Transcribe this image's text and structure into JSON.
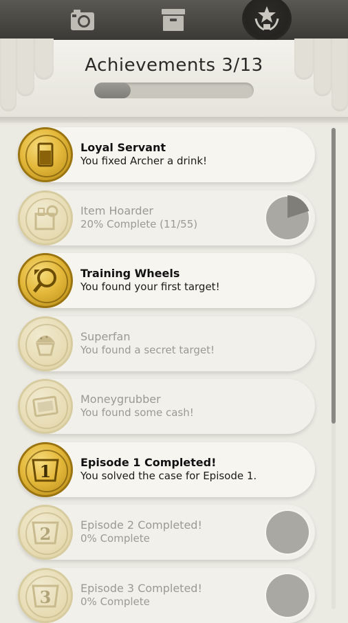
{
  "tabs": [
    {
      "icon": "camera-icon"
    },
    {
      "icon": "box-icon"
    },
    {
      "icon": "trophy-star-icon",
      "active": true
    }
  ],
  "header": {
    "title": "Achievements 3/13",
    "progress": 0.23
  },
  "achievements": [
    {
      "title": "Loyal Servant",
      "desc": "You fixed Archer a drink!",
      "unlocked": true,
      "icon": "drink-glass-icon"
    },
    {
      "title": "Item Hoarder",
      "desc": "20% Complete (11/55)",
      "unlocked": false,
      "icon": "box-items-icon",
      "progress": 0.2
    },
    {
      "title": "Training Wheels",
      "desc": "You found your first target!",
      "unlocked": true,
      "icon": "magnifier-icon"
    },
    {
      "title": "Superfan",
      "desc": "You found a secret target!",
      "unlocked": false,
      "icon": "muffin-icon"
    },
    {
      "title": "Moneygrubber",
      "desc": "You found some cash!",
      "unlocked": false,
      "icon": "cash-icon"
    },
    {
      "title": "Episode 1 Completed!",
      "desc": "You solved the case for Episode 1.",
      "unlocked": true,
      "icon": "episode-1-icon"
    },
    {
      "title": "Episode 2 Completed!",
      "desc": "0% Complete",
      "unlocked": false,
      "icon": "episode-2-icon",
      "progress": 0
    },
    {
      "title": "Episode 3 Completed!",
      "desc": "0% Complete",
      "unlocked": false,
      "icon": "episode-3-icon",
      "progress": 0
    }
  ],
  "colors": {
    "gold": "#e4b83a",
    "topbar": "#4a4844",
    "pie_bg": "#a9a8a2",
    "pie_fill": "#7f7e79"
  }
}
